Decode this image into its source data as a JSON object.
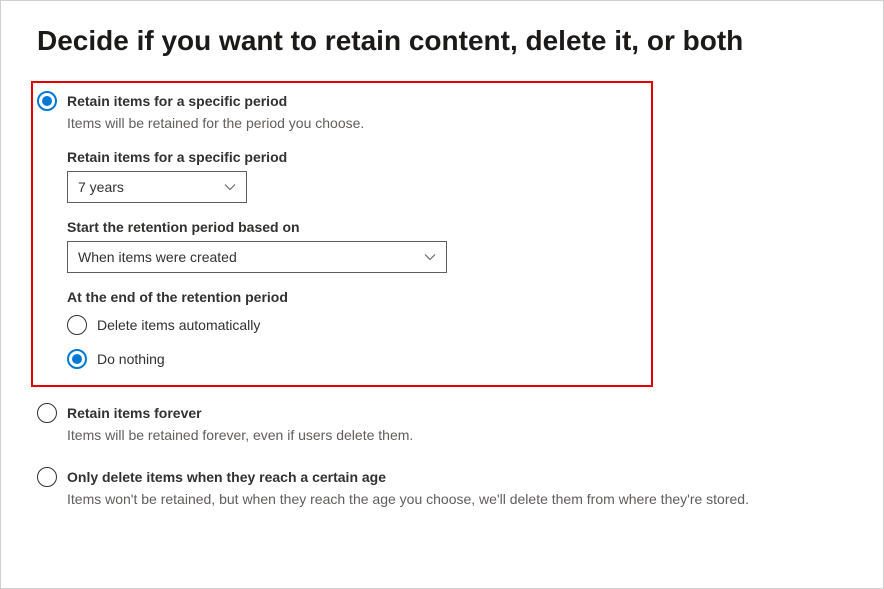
{
  "page": {
    "title": "Decide if you want to retain content, delete it, or both"
  },
  "options": {
    "retain_specific": {
      "title": "Retain items for a specific period",
      "description": "Items will be retained for the period you choose.",
      "period_label": "Retain items for a specific period",
      "period_value": "7 years",
      "start_label": "Start the retention period based on",
      "start_value": "When items were created",
      "end_label": "At the end of the retention period",
      "end_options": {
        "delete": "Delete items automatically",
        "nothing": "Do nothing"
      }
    },
    "retain_forever": {
      "title": "Retain items forever",
      "description": "Items will be retained forever, even if users delete them."
    },
    "only_delete": {
      "title": "Only delete items when they reach a certain age",
      "description": "Items won't be retained, but when they reach the age you choose, we'll delete them from where they're stored."
    }
  }
}
